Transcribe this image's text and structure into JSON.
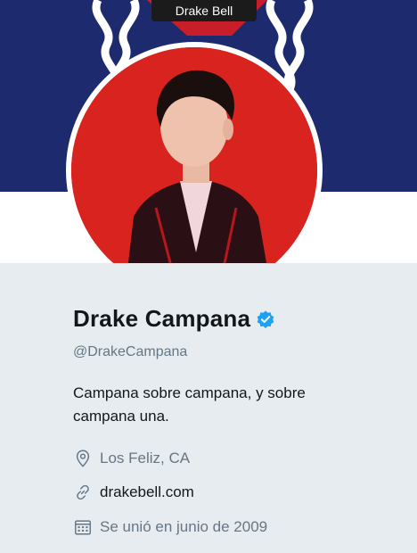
{
  "tooltip": {
    "text": "Drake Bell"
  },
  "profile": {
    "display_name": "Drake Campana",
    "handle": "@DrakeCampana",
    "bio": "Campana sobre campana, y sobre campana una.",
    "location": "Los Feliz, CA",
    "website": "drakebell.com",
    "joined": "Se unió en junio de 2009"
  },
  "icons": {
    "verified": "verified-badge-icon",
    "location": "location-pin-icon",
    "link": "link-icon",
    "calendar": "calendar-icon"
  },
  "colors": {
    "banner_blue": "#1d2a6e",
    "avatar_red": "#d9231f",
    "verified_blue": "#1da1f2",
    "muted_text": "#657786",
    "background": "#e6ecf0"
  }
}
